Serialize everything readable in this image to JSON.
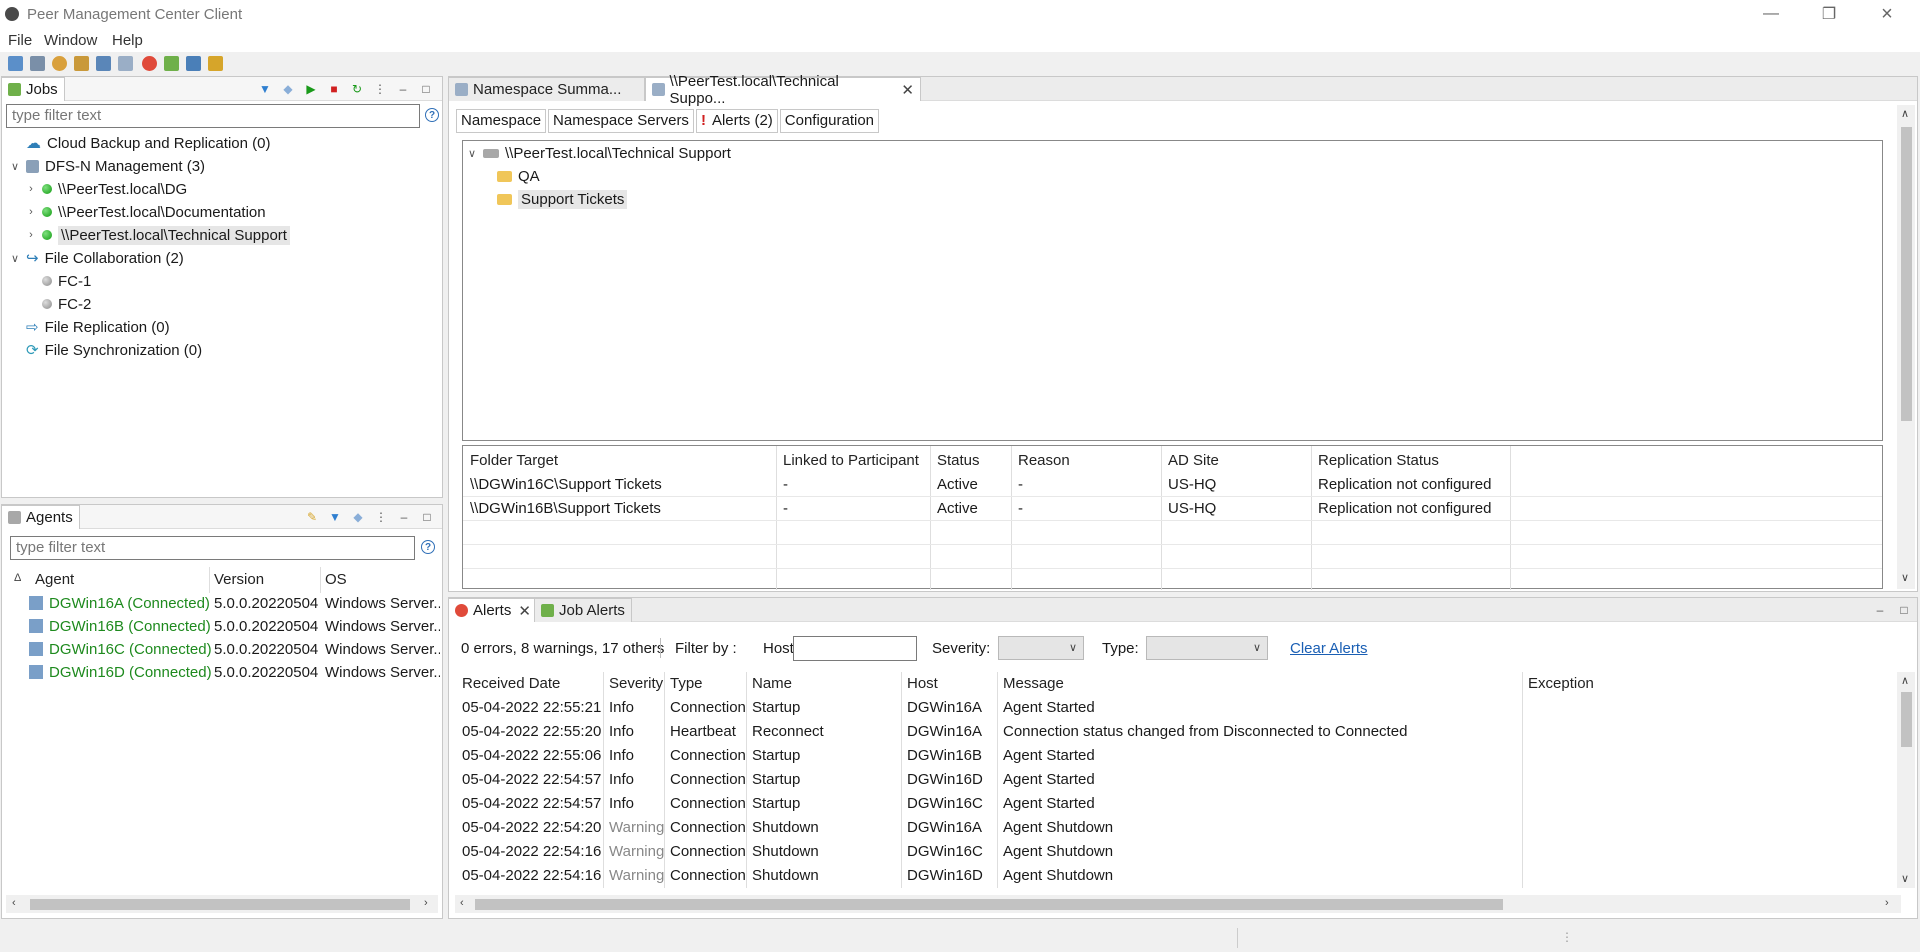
{
  "window": {
    "title": "Peer Management Center Client"
  },
  "menu": [
    "File",
    "Window",
    "Help"
  ],
  "jobs_panel": {
    "tab_label": "Jobs",
    "filter_placeholder": "type filter text",
    "tree": [
      {
        "label": "Cloud Backup and Replication (0)"
      },
      {
        "label": "DFS-N Management (3)"
      },
      {
        "label": "\\\\PeerTest.local\\DG"
      },
      {
        "label": "\\\\PeerTest.local\\Documentation"
      },
      {
        "label": "\\\\PeerTest.local\\Technical Support"
      },
      {
        "label": "File Collaboration (2)"
      },
      {
        "label": "FC-1"
      },
      {
        "label": "FC-2"
      },
      {
        "label": "File Replication (0)"
      },
      {
        "label": "File Synchronization (0)"
      }
    ]
  },
  "agents_panel": {
    "tab_label": "Agents",
    "filter_placeholder": "type filter text",
    "columns": [
      "Agent",
      "Version",
      "OS"
    ],
    "rows": [
      {
        "agent": "DGWin16A (Connected)",
        "version": "5.0.0.20220504",
        "os": "Windows Server.."
      },
      {
        "agent": "DGWin16B (Connected)",
        "version": "5.0.0.20220504",
        "os": "Windows Server.."
      },
      {
        "agent": "DGWin16C (Connected)",
        "version": "5.0.0.20220504",
        "os": "Windows Server.."
      },
      {
        "agent": "DGWin16D (Connected)",
        "version": "5.0.0.20220504",
        "os": "Windows Server.."
      }
    ]
  },
  "editor": {
    "tabs": [
      "Namespace Summa...",
      "\\\\PeerTest.local\\Technical Suppo..."
    ],
    "subtabs": [
      "Namespace",
      "Namespace Servers",
      "Alerts (2)",
      "Configuration"
    ],
    "ns_tree": {
      "root": "\\\\PeerTest.local\\Technical Support",
      "children": [
        "QA",
        "Support Tickets"
      ]
    },
    "targets": {
      "columns": [
        "Folder Target",
        "Linked to Participant",
        "Status",
        "Reason",
        "AD Site",
        "Replication Status"
      ],
      "rows": [
        {
          "target": "\\\\DGWin16C\\Support Tickets",
          "linked": "-",
          "status": "Active",
          "reason": "-",
          "site": "US-HQ",
          "repl": "Replication not configured"
        },
        {
          "target": "\\\\DGWin16B\\Support Tickets",
          "linked": "-",
          "status": "Active",
          "reason": "-",
          "site": "US-HQ",
          "repl": "Replication not configured"
        }
      ]
    }
  },
  "alerts_panel": {
    "tabs": [
      "Alerts",
      "Job Alerts"
    ],
    "summary": "0 errors, 8 warnings, 17 others",
    "filter_by": "Filter by :",
    "host_label": "Host:",
    "severity_label": "Severity:",
    "type_label": "Type:",
    "clear_label": "Clear Alerts",
    "columns": [
      "Received Date",
      "Severity",
      "Type",
      "Name",
      "Host",
      "Message",
      "Exception"
    ],
    "rows": [
      {
        "date": "05-04-2022 22:55:21",
        "severity": "Info",
        "type": "Connection",
        "name": "Startup",
        "host": "DGWin16A",
        "message": "Agent Started"
      },
      {
        "date": "05-04-2022 22:55:20",
        "severity": "Info",
        "type": "Heartbeat",
        "name": "Reconnect",
        "host": "DGWin16A",
        "message": "Connection status changed from Disconnected to Connected"
      },
      {
        "date": "05-04-2022 22:55:06",
        "severity": "Info",
        "type": "Connection",
        "name": "Startup",
        "host": "DGWin16B",
        "message": "Agent Started"
      },
      {
        "date": "05-04-2022 22:54:57",
        "severity": "Info",
        "type": "Connection",
        "name": "Startup",
        "host": "DGWin16D",
        "message": "Agent Started"
      },
      {
        "date": "05-04-2022 22:54:57",
        "severity": "Info",
        "type": "Connection",
        "name": "Startup",
        "host": "DGWin16C",
        "message": "Agent Started"
      },
      {
        "date": "05-04-2022 22:54:20",
        "severity": "Warning",
        "type": "Connection",
        "name": "Shutdown",
        "host": "DGWin16A",
        "message": "Agent Shutdown"
      },
      {
        "date": "05-04-2022 22:54:16",
        "severity": "Warning",
        "type": "Connection",
        "name": "Shutdown",
        "host": "DGWin16C",
        "message": "Agent Shutdown"
      },
      {
        "date": "05-04-2022 22:54:16",
        "severity": "Warning",
        "type": "Connection",
        "name": "Shutdown",
        "host": "DGWin16D",
        "message": "Agent Shutdown"
      }
    ]
  }
}
